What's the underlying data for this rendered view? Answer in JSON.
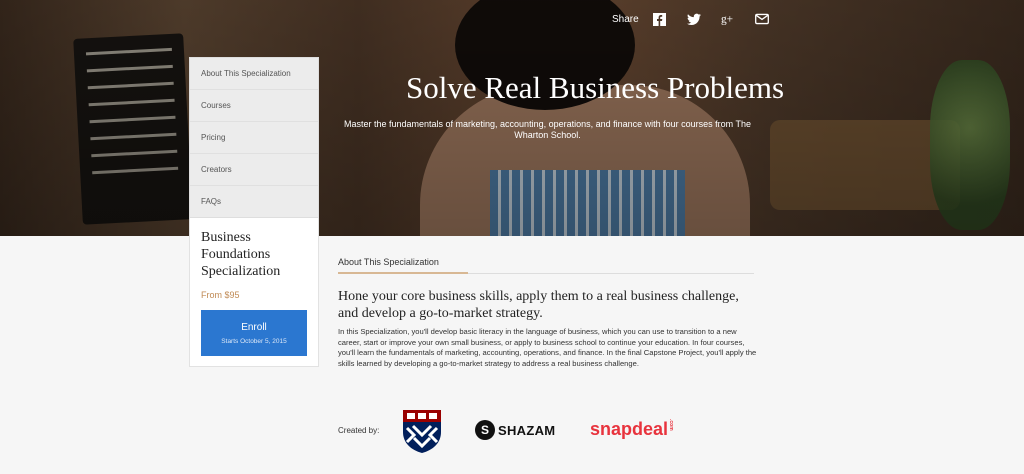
{
  "hero": {
    "share_label": "Share",
    "share_icons": [
      "facebook-icon",
      "twitter-icon",
      "google-plus-icon",
      "email-icon"
    ],
    "title": "Solve Real Business Problems",
    "subtitle": "Master the fundamentals of marketing, accounting, operations, and finance with four courses from The Wharton School."
  },
  "sidebar": {
    "items": [
      {
        "label": "About This Specialization"
      },
      {
        "label": "Courses"
      },
      {
        "label": "Pricing"
      },
      {
        "label": "Creators"
      },
      {
        "label": "FAQs"
      }
    ]
  },
  "card": {
    "title": "Business Foundations Specialization",
    "price": "From $95",
    "enroll_label": "Enroll",
    "enroll_sub": "Starts October 5, 2015"
  },
  "main": {
    "tab_label": "About This Specialization",
    "headline": "Hone your core business skills, apply them to a real business challenge, and develop a go-to-market strategy.",
    "body": "In this Specialization, you'll develop basic literacy in the language of business, which you can use to transition to a new career, start or improve your own small business, or apply to business school to continue your education. In four courses, you'll learn the fundamentals of marketing, accounting, operations, and finance. In the final Capstone Project, you'll apply the skills learned by developing a go-to-market strategy to address a real business challenge.",
    "created_by": "Created by:",
    "logos": {
      "shazam": "SHAZAM",
      "snapdeal": "snapdeal",
      "snapdeal_suffix": ".com"
    }
  },
  "colors": {
    "accent_blue": "#2b77d0",
    "price_color": "#c08a54",
    "tab_accent": "#d8b894",
    "penn_blue": "#011f5b",
    "penn_red": "#990000"
  }
}
